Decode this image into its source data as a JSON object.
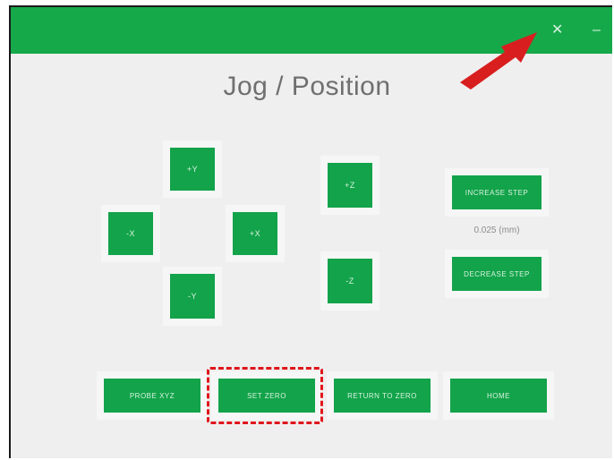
{
  "header": {
    "title": "Jog / Position"
  },
  "toolbar": {
    "icons": [
      "close-icon",
      "minimize-icon"
    ],
    "close_glyph": "✕",
    "min_glyph": "–"
  },
  "jog": {
    "up_label": "+Y",
    "left_label": "-X",
    "right_label": "+X",
    "down_label": "-Y",
    "z_up_label": "+Z",
    "z_down_label": "-Z"
  },
  "step": {
    "increase_label": "INCREASE STEP",
    "value_label": "0.025 (mm)",
    "decrease_label": "DECREASE STEP"
  },
  "actions": [
    {
      "label": "PROBE XYZ"
    },
    {
      "label": "SET ZERO"
    },
    {
      "label": "RETURN TO ZERO"
    },
    {
      "label": "HOME"
    }
  ],
  "colors": {
    "accent": "#16a94a",
    "highlight": "#e0161b",
    "pointer": "#d81e1e"
  }
}
